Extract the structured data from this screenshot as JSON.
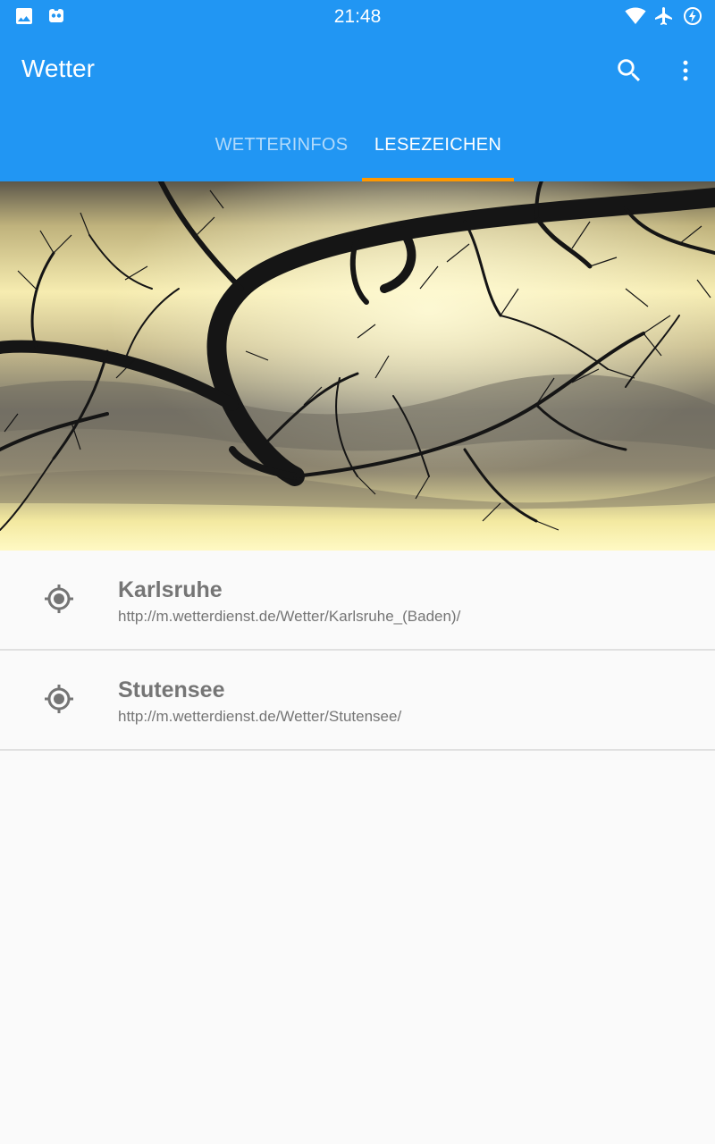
{
  "status_bar": {
    "time": "21:48",
    "left_icons": [
      "image-icon",
      "robot-icon"
    ],
    "right_icons": [
      "wifi-icon",
      "airplane-mode-icon",
      "battery-charging-icon"
    ]
  },
  "app_bar": {
    "title": "Wetter",
    "background_color": "#2196f3",
    "actions": [
      "search-icon",
      "more-vert-icon"
    ]
  },
  "tabs": [
    {
      "label": "WETTERINFOS",
      "selected": false
    },
    {
      "label": "LESEZEICHEN",
      "selected": true
    }
  ],
  "tab_indicator_color": "#ff9800",
  "bookmarks": [
    {
      "name": "Karlsruhe",
      "url": "http://m.wetterdienst.de/Wetter/Karlsruhe_(Baden)/",
      "icon": "location-target-icon"
    },
    {
      "name": "Stutensee",
      "url": "http://m.wetterdienst.de/Wetter/Stutensee/",
      "icon": "location-target-icon"
    }
  ]
}
